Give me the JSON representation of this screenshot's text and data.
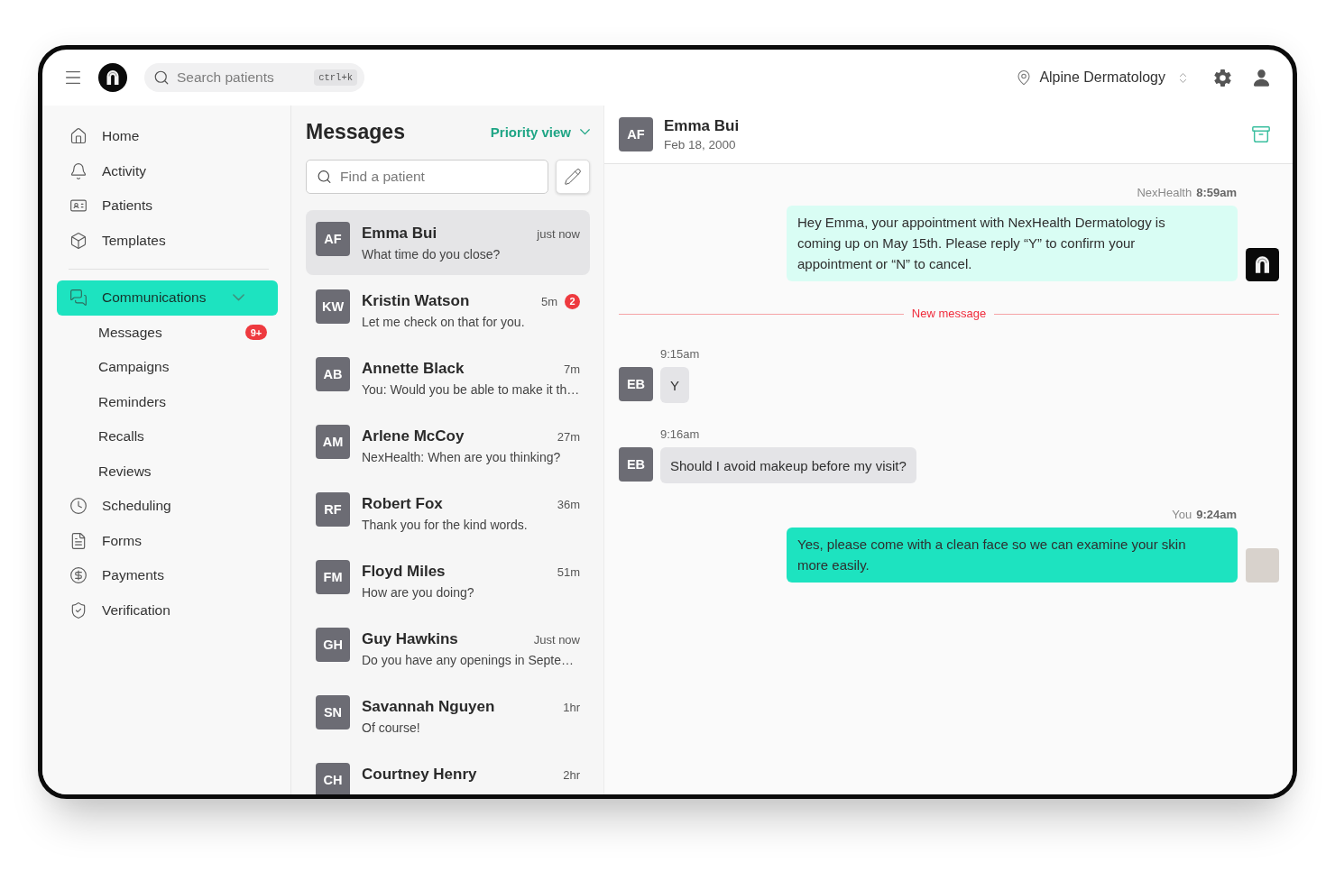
{
  "topbar": {
    "search": {
      "placeholder": "Search patients",
      "shortcut": "ctrl+k"
    },
    "location": "Alpine Dermatology"
  },
  "sidebar": {
    "groups": [
      {
        "items": [
          {
            "label": "Home",
            "selected": false
          },
          {
            "label": "Activity",
            "selected": false
          },
          {
            "label": "Patients",
            "selected": false
          },
          {
            "label": "Templates",
            "selected": false
          }
        ]
      },
      {
        "items": [
          {
            "label": "Communications",
            "selected": true,
            "expanded": true,
            "children": [
              {
                "label": "Messages",
                "selected": false,
                "badge": "9+"
              },
              {
                "label": "Campaigns",
                "selected": false
              },
              {
                "label": "Reminders",
                "selected": false
              },
              {
                "label": "Recalls",
                "selected": false
              },
              {
                "label": "Reviews",
                "selected": false
              }
            ]
          },
          {
            "label": "Scheduling",
            "selected": false
          },
          {
            "label": "Forms",
            "selected": false
          },
          {
            "label": "Payments",
            "selected": false
          },
          {
            "label": "Verification",
            "selected": false
          }
        ]
      }
    ]
  },
  "message_list": {
    "title": "Messages",
    "view": "Priority view",
    "search": {
      "placeholder": "Find a patient"
    },
    "conversations": [
      {
        "initials": "AF",
        "name": "Emma Bui",
        "time": "just now",
        "preview": "What time do you close?",
        "selected": true
      },
      {
        "initials": "KW",
        "name": "Kristin Watson",
        "time": "5m",
        "badge": "2",
        "preview": "Let me check on that for you.",
        "selected": false
      },
      {
        "initials": "AB",
        "name": "Annette Black",
        "time": "7m",
        "preview": "You: Would you be able to make it th…",
        "selected": false
      },
      {
        "initials": "AM",
        "name": "Arlene McCoy",
        "time": "27m",
        "preview": "NexHealth: When are you thinking?",
        "selected": false
      },
      {
        "initials": "RF",
        "name": "Robert Fox",
        "time": "36m",
        "preview": "Thank you for the kind words.",
        "selected": false
      },
      {
        "initials": "FM",
        "name": "Floyd Miles",
        "time": "51m",
        "preview": "How are you doing?",
        "selected": false
      },
      {
        "initials": "GH",
        "name": "Guy Hawkins",
        "time": "Just now",
        "preview": "Do you have any openings in Septe…",
        "selected": false
      },
      {
        "initials": "SN",
        "name": "Savannah Nguyen",
        "time": "1hr",
        "preview": "Of course!",
        "selected": false
      },
      {
        "initials": "CH",
        "name": "Courtney Henry",
        "time": "2hr",
        "selected": false
      }
    ]
  },
  "chat": {
    "header": {
      "initials": "AF",
      "name": "Emma Bui",
      "date": "Feb 18, 2000"
    },
    "messages": [
      {
        "kind": "automated",
        "sender": "NexHealth",
        "time": "8:59am",
        "text": "Hey Emma, your appointment with NexHealth Dermatology is coming up on May 15th. Please reply “Y” to confirm your appointment or “N” to cancel."
      },
      {
        "kind": "divider",
        "text": "New message"
      },
      {
        "kind": "received",
        "time": "9:15am",
        "initials": "EB",
        "text": "Y"
      },
      {
        "kind": "received",
        "time": "9:16am",
        "initials": "EB",
        "text": "Should I avoid makeup before my visit?"
      },
      {
        "kind": "sent",
        "sender": "You",
        "time": "9:24am",
        "text": "Yes, please come with a clean face so we can examine your skin more easily."
      }
    ]
  }
}
